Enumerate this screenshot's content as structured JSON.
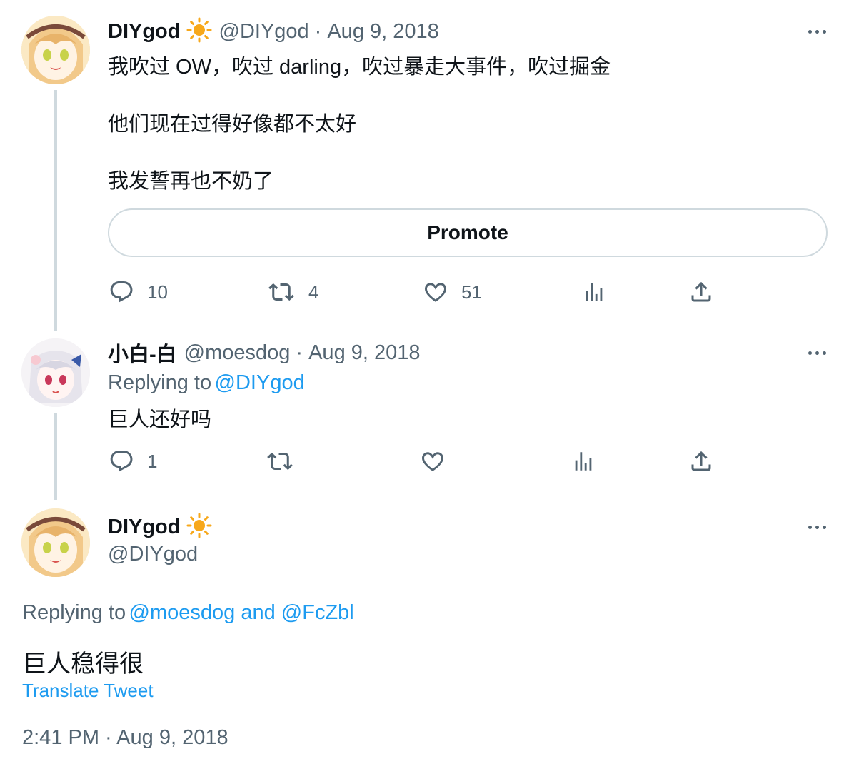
{
  "tweets": [
    {
      "author_name": "DIYgod",
      "author_handle": "@DIYgod",
      "date": "Aug 9, 2018",
      "lines": [
        "我吹过 OW，吹过 darling，吹过暴走大事件，吹过掘金",
        "他们现在过得好像都不太好",
        "我发誓再也不奶了"
      ],
      "promote_label": "Promote",
      "reply_count": "10",
      "retweet_count": "4",
      "like_count": "51"
    },
    {
      "author_name": "小白-白",
      "author_handle": "@moesdog",
      "date": "Aug 9, 2018",
      "replying_prefix": "Replying to",
      "replying_to": "@DIYgod",
      "text": "巨人还好吗",
      "reply_count": "1"
    }
  ],
  "main_tweet": {
    "author_name": "DIYgod",
    "author_handle": "@DIYgod",
    "replying_prefix": "Replying to",
    "replying_to": "@moesdog and @FcZbl",
    "text": "巨人稳得很",
    "translate_label": "Translate Tweet",
    "timestamp": "2:41 PM · Aug 9, 2018"
  },
  "separator": "·",
  "icons": {
    "reply": "reply-icon",
    "retweet": "retweet-icon",
    "like": "heart-icon",
    "views": "analytics-icon",
    "share": "share-icon",
    "more": "more-icon",
    "badge": "sun-icon"
  },
  "colors": {
    "accent": "#1d9bf0",
    "text": "#0f1419",
    "secondary": "#536471",
    "border": "#cfd9de",
    "sun": "#f7a81b"
  }
}
